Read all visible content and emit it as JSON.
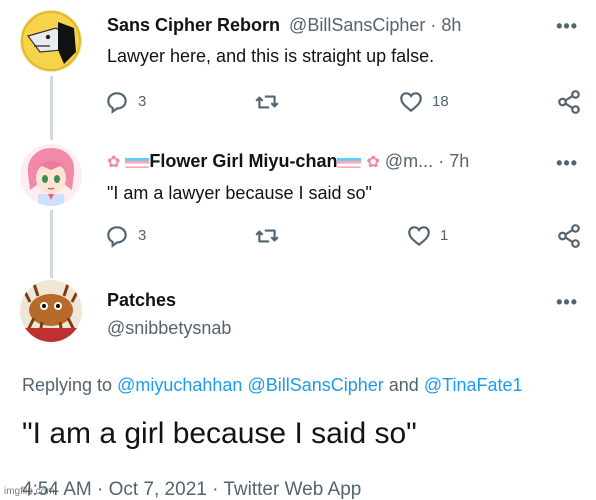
{
  "tweet1": {
    "display_name": "Sans Cipher Reborn",
    "handle": "@BillSansCipher",
    "separator": "·",
    "time": "8h",
    "text": "Lawyer here, and this is straight up false.",
    "reply_count": "3",
    "retweet_count": "",
    "like_count": "18",
    "more": "•••",
    "icons": [
      "reply-icon",
      "retweet-icon",
      "heart-icon",
      "share-icon"
    ]
  },
  "tweet2": {
    "display_name": "Flower Girl Miyu-chan",
    "handle": "@m...",
    "separator": "·",
    "time": "7h",
    "text": "\"I am a lawyer because I said so\"",
    "reply_count": "3",
    "retweet_count": "",
    "like_count": "1",
    "more": "•••",
    "icons": [
      "flower-icon",
      "trans-flag-icon"
    ]
  },
  "tweet3": {
    "display_name": "Patches",
    "handle": "@snibbetysnab",
    "more": "•••",
    "replying_prefix": "Replying to",
    "mention_1": "@miyuchahhan",
    "mention_2": "@BillSansCipher",
    "and_word": "and",
    "mention_3": "@TinaFate1",
    "text": "\"I am a girl because I said so\"",
    "timestamp": "4:54 AM · Oct 7, 2021 · Twitter Web App"
  },
  "watermark": "imgflip.com",
  "colors": {
    "text": "#0f1419",
    "secondary": "#536471",
    "link": "#1d9bf0",
    "thread_line": "#cfd9de",
    "trans_blue": "#5bcefa",
    "trans_pink": "#f5a9b8"
  }
}
